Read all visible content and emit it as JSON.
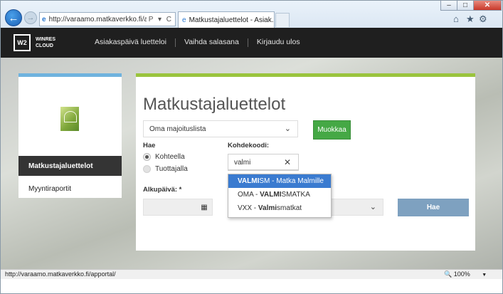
{
  "browser": {
    "url": "http://varaamo.matkaverkko.fi/apport",
    "url_domain": "matkaverkko.fi",
    "url_tools": "P ▾ C",
    "tab_title": "Matkustajaluettelot - Asiak...",
    "status_url": "http://varaamo.matkaverkko.fi/apportal/",
    "zoom": "100%"
  },
  "header": {
    "logo_mark": "W2",
    "logo_line1": "WINRES",
    "logo_line2": "CLOUD",
    "menu": [
      "Asiakaspäivä luetteloi",
      "Vaihda salasana",
      "Kirjaudu ulos"
    ]
  },
  "sidebar": {
    "active_item": "Matkustajaluettelot",
    "item": "Myyntiraportit"
  },
  "main": {
    "title": "Matkustajaluettelot",
    "list_select": "Oma majoituslista",
    "edit_button": "Muokkaa",
    "search_by_label": "Hae",
    "radio_by_destination": "Kohteella",
    "radio_by_producer": "Tuottajalla",
    "code_label": "Kohdekoodi:",
    "code_value": "valmi",
    "start_date_label": "Alkupäivä: *",
    "search_button": "Hae"
  },
  "autocomplete": [
    {
      "match": "VALMI",
      "rest": "SM - Matka Malmille",
      "prefix": ""
    },
    {
      "prefix": "OMA - ",
      "match": "VALMI",
      "rest": "SMATKA"
    },
    {
      "prefix": "VXX - ",
      "match": "Valmi",
      "rest": "smatkat"
    }
  ]
}
